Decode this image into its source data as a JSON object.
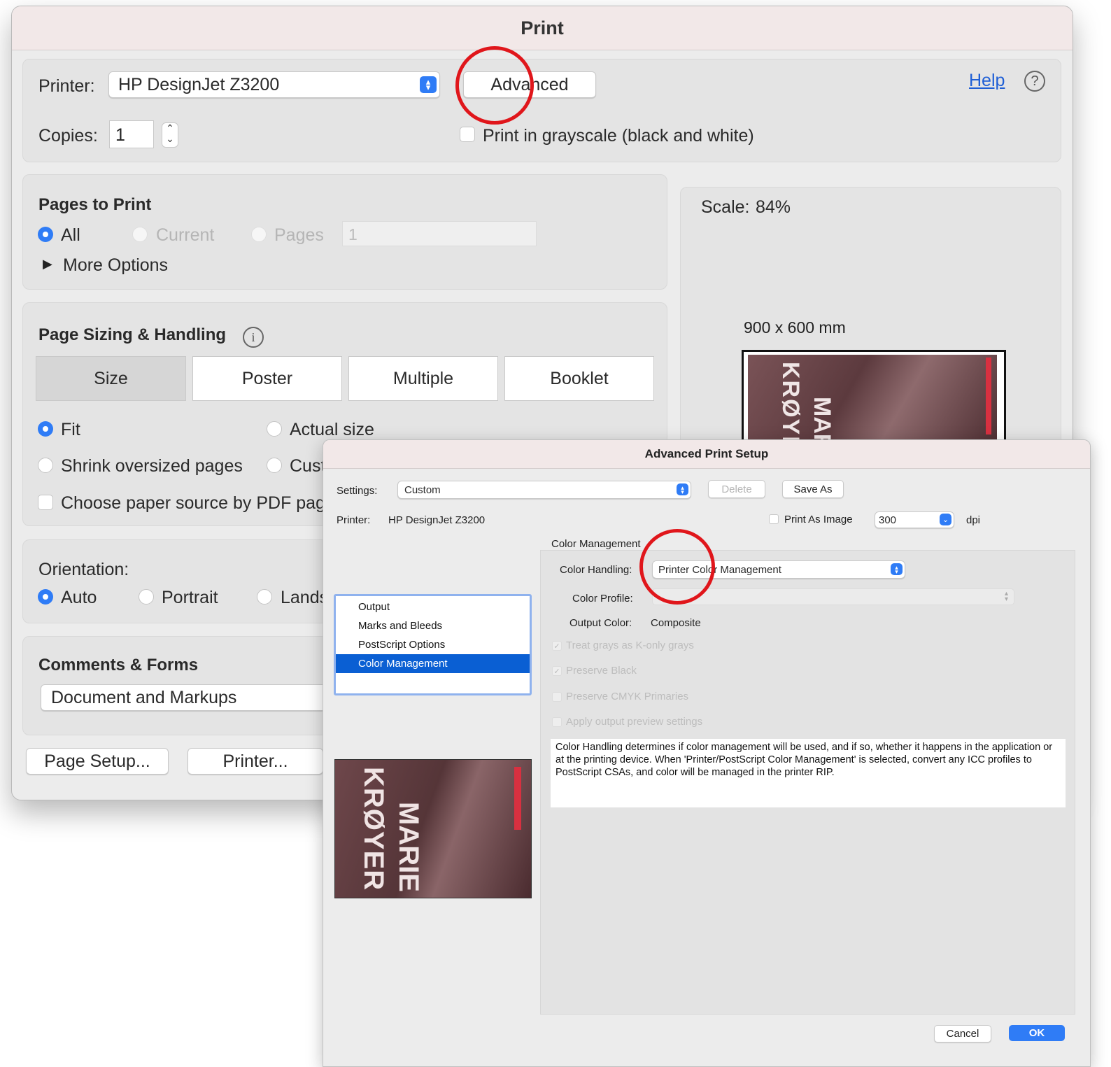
{
  "print_dialog": {
    "title": "Print",
    "printer_label": "Printer:",
    "printer_value": "HP DesignJet Z3200",
    "advanced_label": "Advanced",
    "help_label": "Help",
    "help_icon": "question-circle-icon",
    "copies_label": "Copies:",
    "copies_value": "1",
    "grayscale_label": "Print in grayscale (black and white)",
    "grayscale_checked": false,
    "pages_to_print": {
      "heading": "Pages to Print",
      "all_label": "All",
      "current_label": "Current",
      "pages_label": "Pages",
      "pages_value": "1",
      "selected": "All",
      "more_options_label": "More Options"
    },
    "page_sizing": {
      "heading": "Page Sizing & Handling",
      "info_icon": "info-icon",
      "tabs": [
        "Size",
        "Poster",
        "Multiple",
        "Booklet"
      ],
      "active_tab": "Size",
      "fit_label": "Fit",
      "actual_size_label": "Actual size",
      "shrink_label": "Shrink oversized pages",
      "custom_label": "Cust",
      "paper_source_label": "Choose paper source by PDF pag",
      "selected": "Fit"
    },
    "orientation": {
      "heading": "Orientation:",
      "auto_label": "Auto",
      "portrait_label": "Portrait",
      "landscape_label": "Lands",
      "selected": "Auto"
    },
    "comments_forms": {
      "heading": "Comments & Forms",
      "value": "Document and Markups"
    },
    "page_setup_label": "Page Setup...",
    "printer_button_label": "Printer...",
    "preview": {
      "scale_label": "Scale:",
      "scale_value": "84%",
      "size_label": "900 x 600 mm"
    }
  },
  "advanced_dialog": {
    "title": "Advanced Print Setup",
    "settings_label": "Settings:",
    "settings_value": "Custom",
    "delete_label": "Delete",
    "save_as_label": "Save As",
    "printer_label": "Printer:",
    "printer_value": "HP DesignJet Z3200",
    "print_as_image_label": "Print As Image",
    "dpi_value": "300",
    "dpi_label": "dpi",
    "nav_items": [
      "Output",
      "Marks and Bleeds",
      "PostScript Options",
      "Color Management"
    ],
    "nav_selected": "Color Management",
    "section_title": "Color Management",
    "color_handling_label": "Color Handling:",
    "color_handling_value": "Printer Color Management",
    "color_profile_label": "Color Profile:",
    "output_color_label": "Output Color:",
    "output_color_value": "Composite",
    "treat_grays_label": "Treat grays as K-only grays",
    "preserve_black_label": "Preserve Black",
    "preserve_cmyk_label": "Preserve CMYK Primaries",
    "apply_preview_label": "Apply output preview settings",
    "description": "Color Handling determines if color management will be used, and if so, whether it happens in the application or at the printing device. When 'Printer/PostScript Color Management' is selected, convert any ICC profiles to PostScript CSAs, and color will be managed in the printer RIP.",
    "cancel_label": "Cancel",
    "ok_label": "OK"
  },
  "poster_text": {
    "name_line1": "MARIE",
    "name_line2": "KRØYER"
  },
  "colors": {
    "accent_blue": "#2f7cf6",
    "selection_blue": "#0a5fd3",
    "annotation_red": "#e0161b",
    "poster_tint": "#6b4448",
    "title_bar": "#f2e8e8"
  }
}
